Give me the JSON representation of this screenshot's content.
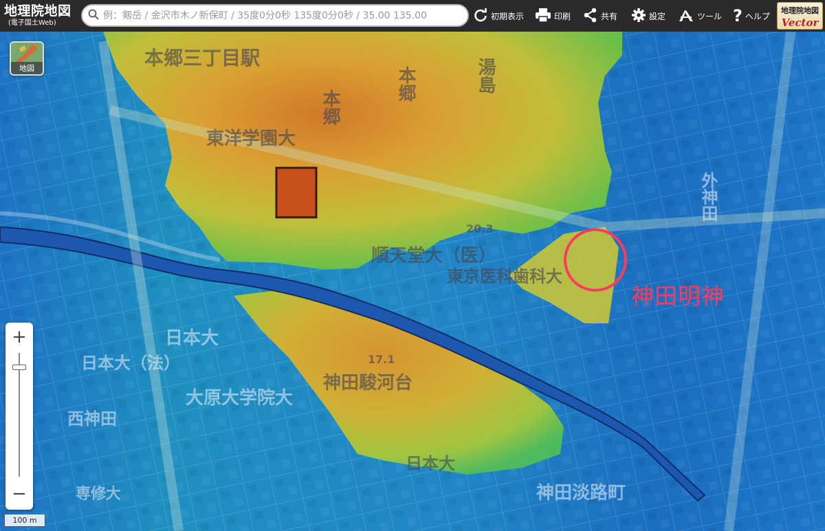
{
  "header": {
    "app_title": "地理院地図",
    "app_subtitle": "(電子国土Web)",
    "search_placeholder": "例：剱岳 / 金沢市木ノ新保町 / 35度0分0秒 135度0分0秒 / 35.00 135.00",
    "buttons": [
      {
        "label": "初期表示",
        "icon": "reset-icon"
      },
      {
        "label": "印刷",
        "icon": "print-icon"
      },
      {
        "label": "共有",
        "icon": "share-icon"
      },
      {
        "label": "設定",
        "icon": "gear-icon"
      },
      {
        "label": "ツール",
        "icon": "tool-icon"
      },
      {
        "label": "ヘルプ",
        "icon": "help-icon"
      }
    ],
    "vector_badge": {
      "line1": "地理院地図",
      "line2": "Vector"
    }
  },
  "map_type_button": {
    "label": "地図"
  },
  "zoom": {
    "in_label": "+",
    "out_label": "−"
  },
  "scale": {
    "label": "100 m"
  },
  "annotation": {
    "label": "神田明神",
    "color": "#ff3a5a"
  },
  "map_labels": {
    "hongo_sanchome_station": "本郷三丁目駅",
    "hongo_sanchome_vertical": "本郷三丁目駅",
    "hongo_vertical_1": "本郷",
    "hongo_vertical_2": "本郷",
    "toyo_gakuen": "東洋学園大",
    "juntendo": "順天堂大（医）",
    "tokyo_ika": "東京医科歯科大",
    "nihon_dai": "日本大",
    "nihon_dai_law": "日本大（法）",
    "ohara": "大原大学院大",
    "nishikanda": "西神田",
    "kanda_surugadai": "神田駿河台",
    "yushima": "湯島",
    "sotokanda": "外神田",
    "senshu": "専修大",
    "awajicho": "神田淡路町",
    "height_1": "20.3",
    "height_2": "17.1"
  },
  "colors": {
    "low": "#1f6fc2",
    "mid_low": "#1fa6b8",
    "mid": "#8fd03a",
    "high": "#e8c23a",
    "top": "#d9771e",
    "river": "#1d58b0"
  }
}
